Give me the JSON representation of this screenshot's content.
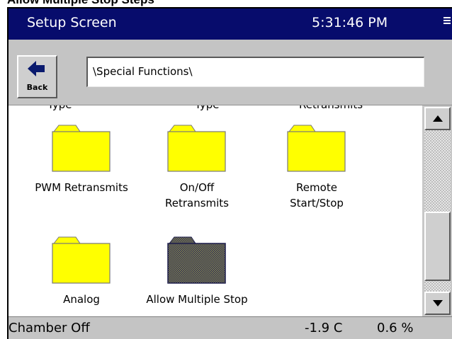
{
  "caption": "Allow Multiple Stop Steps",
  "titlebar": {
    "title": "Setup Screen",
    "time": "5:31:46 PM",
    "menu_icon": "menu-icon"
  },
  "toolbar": {
    "back_label": "Back",
    "back_icon": "left-arrow-icon",
    "path": "\\Special Functions\\"
  },
  "content": {
    "cut_off_labels": [
      "Type",
      "Type",
      "Retransmits"
    ],
    "items": [
      {
        "label_line1": "PWM Retransmits",
        "label_line2": "",
        "icon": "folder-icon",
        "selected": false
      },
      {
        "label_line1": "On/Off",
        "label_line2": "Retransmits",
        "icon": "folder-icon",
        "selected": false
      },
      {
        "label_line1": "Remote",
        "label_line2": "Start/Stop",
        "icon": "folder-icon",
        "selected": false
      },
      {
        "label_line1": "Analog",
        "label_line2": "",
        "icon": "folder-icon",
        "selected": false
      },
      {
        "label_line1": "Allow Multiple Stop",
        "label_line2": "",
        "icon": "folder-icon",
        "selected": true
      }
    ]
  },
  "scrollbar": {
    "up_icon": "arrow-up-icon",
    "down_icon": "arrow-down-icon"
  },
  "status": {
    "chamber": "Chamber Off",
    "temperature": "-1.9 C",
    "percent": "0.6 %"
  },
  "colors": {
    "titlebar": "#070c6c",
    "folder_fill": "#ffff00",
    "selection": "#0a1a8a",
    "window": "#c4c4c4"
  }
}
